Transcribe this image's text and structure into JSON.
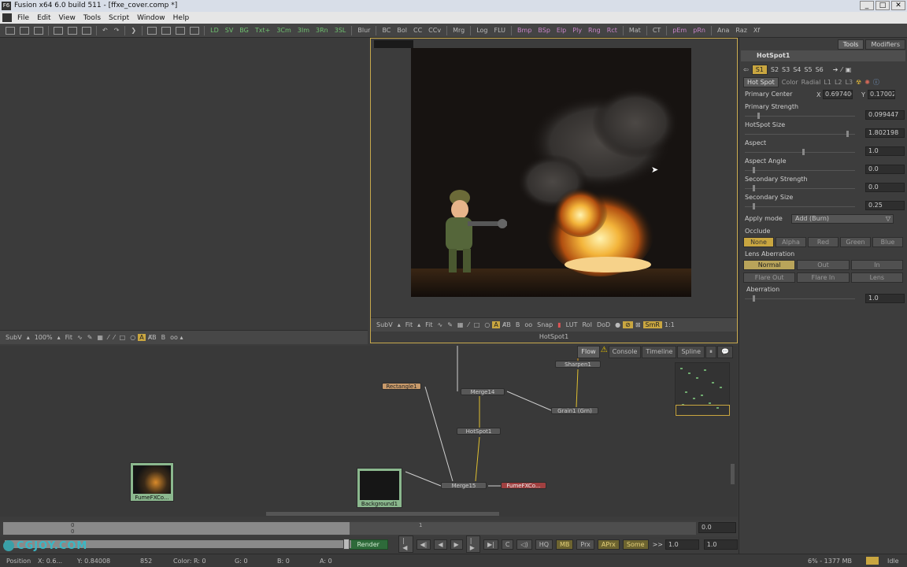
{
  "window": {
    "title": "Fusion x64 6.0 build 511 - [ffxe_cover.comp *]",
    "buttons": [
      "_",
      "□",
      "✕"
    ]
  },
  "menu": [
    "File",
    "Edit",
    "View",
    "Tools",
    "Script",
    "Window",
    "Help"
  ],
  "toolbar": [
    "LD",
    "SV",
    "BG",
    "Txt+",
    "3Cm",
    "3Im",
    "3Rn",
    "3SL",
    "Blur",
    "BC",
    "Bol",
    "CC",
    "CCv",
    "Mrg",
    "Log",
    "FLU",
    "Bmp",
    "BSp",
    "Elp",
    "Ply",
    "Rng",
    "Rct",
    "Mat",
    "CT",
    "pEm",
    "pRn",
    "Ana",
    "Raz",
    "Xf"
  ],
  "toolbar_colors": {
    "green": "#6fc06f",
    "blue": "#7fa6d9",
    "pink": "#c884c8",
    "default": "#b8b8b8"
  },
  "left_viewer": {
    "subv": "SubV",
    "zoom": "100%",
    "fit": "Fit",
    "channel": "A",
    "b": "B"
  },
  "right_viewer": {
    "subv": "SubV",
    "fit1": "Fit",
    "fit2": "Fit",
    "snap": "Snap",
    "lut": "LUT",
    "roi": "RoI",
    "dod": "DoD",
    "smr": "SmR",
    "ratio": "1:1",
    "label": "HotSpot1",
    "channel": "A",
    "b": "B"
  },
  "panel": {
    "tabs": [
      "Tools",
      "Modifiers"
    ],
    "tool_name": "HotSpot1",
    "slots": [
      "S1",
      "S2",
      "S3",
      "S4",
      "S5",
      "S6"
    ],
    "subtabs": [
      "Hot Spot",
      "Color",
      "Radial",
      "L1",
      "L2",
      "L3"
    ],
    "primary_center": {
      "label": "Primary Center",
      "x_label": "X",
      "x": "0.697406",
      "y_label": "Y",
      "y": "0.170028"
    },
    "params": [
      {
        "label": "Primary Strength",
        "value": "0.099447",
        "fraction": 0.05
      },
      {
        "label": "HotSpot Size",
        "value": "1.802198",
        "fraction": 0.95
      },
      {
        "label": "Aspect",
        "value": "1.0",
        "fraction": 0.5
      },
      {
        "label": "Aspect Angle",
        "value": "0.0",
        "fraction": 0.0
      },
      {
        "label": "Secondary Strength",
        "value": "0.0",
        "fraction": 0.0
      },
      {
        "label": "Secondary Size",
        "value": "0.25",
        "fraction": 0.0
      }
    ],
    "apply_mode": {
      "label": "Apply mode",
      "value": "Add (Burn)"
    },
    "occlude": {
      "label": "Occlude",
      "options": [
        "None",
        "Alpha",
        "Red",
        "Green",
        "Blue"
      ],
      "selected": "None"
    },
    "lens_aberration": {
      "label": "Lens Aberration",
      "row1": [
        "Normal",
        "Out",
        "In"
      ],
      "row2": [
        "Flare Out",
        "Flare In",
        "Lens"
      ],
      "selected": "Normal"
    },
    "aberration": {
      "label": "Aberration",
      "value": "1.0",
      "fraction": 0.0
    }
  },
  "flow": {
    "tabs": [
      "Flow",
      "Console",
      "Timeline",
      "Spline"
    ],
    "nodes": {
      "sharpen": "Sharpen1",
      "rectangle": "Rectangle1",
      "merge14": "Merge14",
      "grain": "Grain1  (Grn)",
      "hotspot": "HotSpot1",
      "merge15": "Merge15",
      "fumefx_out": "FumeFXCo...",
      "fumefx_in": "FumeFXCo...",
      "background": "Background1"
    }
  },
  "timeline": {
    "start": "0",
    "end": "0",
    "mid": "1",
    "current": "0.0"
  },
  "transport": {
    "render": "Render",
    "hq": "HQ",
    "mb": "MB",
    "prx": "Prx",
    "aprx": "APrx",
    "some": "Some",
    "step": ">>",
    "v1": "1.0",
    "v2": "1.0"
  },
  "status": {
    "x": "X: 0.6...",
    "y": "Y: 0.84008",
    "frame": "852",
    "color_r": "Color: R: 0",
    "g": "G: 0",
    "b": "B: 0",
    "a": "A: 0",
    "memory": "6% - 1377 MB",
    "state": "Idle",
    "pos_label": "Position"
  },
  "watermark": "CGJOY.COM"
}
